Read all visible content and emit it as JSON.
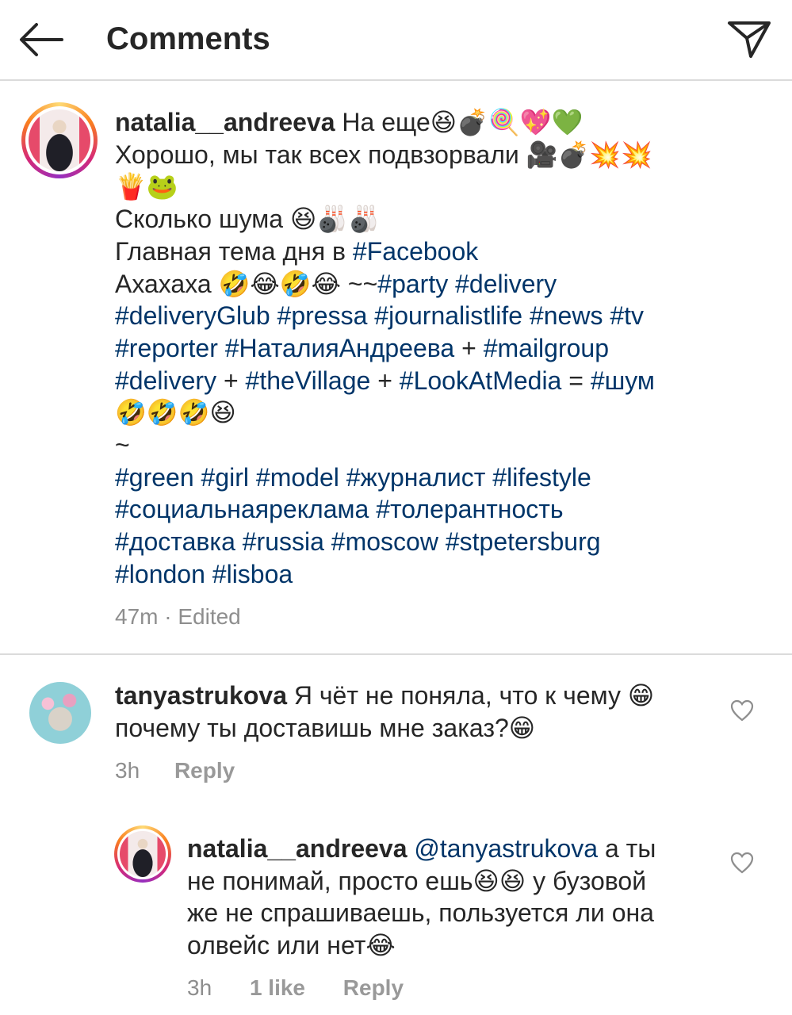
{
  "header": {
    "title": "Comments"
  },
  "caption": {
    "username": "natalia__andreeva",
    "lines": [
      [
        "На еще😆💣🍭💖💚"
      ],
      [
        "Хорошо, мы так всех подвзорвали 🎥💣💥💥"
      ],
      [
        "🍟🐸"
      ],
      [
        "Сколько шума 😆🎳🎳"
      ],
      [
        "Главная тема дня в ",
        "#Facebook"
      ],
      [
        "Ахахаха 🤣😂🤣😂 ~~",
        "#party",
        " ",
        "#delivery"
      ],
      [
        "#deliveryGlub",
        " ",
        "#pressa",
        " ",
        "#journalistlife",
        " ",
        "#news",
        " ",
        "#tv"
      ],
      [
        "#reporter",
        "  ",
        "#НаталияАндреева",
        " + ",
        "#mailgroup"
      ],
      [
        "#delivery",
        " + ",
        "#theVillage",
        " +  ",
        "#LookAtMedia",
        " = ",
        "#шум"
      ],
      [
        "🤣🤣🤣😆"
      ],
      [
        "~"
      ],
      [
        "#green",
        " ",
        "#girl",
        " ",
        "#model",
        " ",
        "#журналист",
        " ",
        "#lifestyle"
      ],
      [
        "#социальнаяреклама",
        " ",
        "#толерантность"
      ],
      [
        "#доставка",
        " ",
        "#russia",
        " ",
        "#moscow",
        " ",
        "#stpetersburg"
      ],
      [
        "#london",
        " ",
        "#lisboa"
      ]
    ],
    "time": "47m",
    "separator": "·",
    "edited": "Edited"
  },
  "comment1": {
    "username": "tanyastrukova",
    "lines": [
      [
        "Я чёт не поняла, что к чему 😁"
      ],
      [
        "почему ты доставишь мне заказ?😁"
      ]
    ],
    "time": "3h",
    "reply_label": "Reply"
  },
  "reply1": {
    "username": "natalia__andreeva",
    "lines": [
      [
        "@tanyastrukova",
        " а ты"
      ],
      [
        "не понимай, просто ешь😆😆 у бузовой"
      ],
      [
        "же не спрашиваешь, пользуется ли она"
      ],
      [
        "олвейс или нет😂"
      ]
    ],
    "time": "3h",
    "likes_label": "1 like",
    "reply_label": "Reply"
  },
  "colors": {
    "link": "#003569",
    "meta": "#8e8e8e",
    "divider": "#dbdbdb"
  },
  "icons": {
    "back": "arrow-left-icon",
    "send": "direct-send-icon",
    "like": "heart-outline-icon"
  }
}
